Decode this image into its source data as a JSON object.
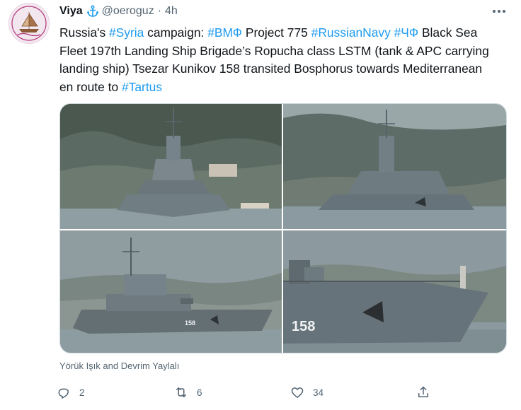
{
  "tweet": {
    "author": {
      "display_name": "Viya",
      "handle": "@oeroguz",
      "separator": "·",
      "time": "4h",
      "badge_icon": "anchor-icon"
    },
    "text_segments": [
      {
        "text": "Russia's ",
        "hashtag": false
      },
      {
        "text": "#Syria",
        "hashtag": true
      },
      {
        "text": " campaign: ",
        "hashtag": false
      },
      {
        "text": "#ВМФ",
        "hashtag": true
      },
      {
        "text": " Project 775 ",
        "hashtag": false
      },
      {
        "text": "#RussianNavy",
        "hashtag": true
      },
      {
        "text": " ",
        "hashtag": false
      },
      {
        "text": "#ЧФ",
        "hashtag": true
      },
      {
        "text": " Black Sea Fleet 197th Landing Ship Brigade’s Ropucha class LSTM (tank & APC carrying landing ship) Tsezar Kunikov 158 transited Bosphorus towards Mediterranean en route to ",
        "hashtag": false
      },
      {
        "text": "#Tartus",
        "hashtag": true
      }
    ],
    "photo_credit": "Yörük Işık and Devrim Yaylalı",
    "photos": [
      {
        "name": "ship-photo-bow-front",
        "hull_number": ""
      },
      {
        "name": "ship-photo-bow-distant",
        "hull_number": ""
      },
      {
        "name": "ship-photo-side",
        "hull_number": "158"
      },
      {
        "name": "ship-photo-bow-closeup",
        "hull_number": "158"
      }
    ],
    "actions": {
      "reply_count": "2",
      "retweet_count": "6",
      "like_count": "34"
    }
  },
  "colors": {
    "link": "#1d9bf0",
    "secondary_text": "#536471",
    "primary_text": "#0f1419",
    "hull_gray": "#6f7a80",
    "water": "#8b9aa0"
  }
}
